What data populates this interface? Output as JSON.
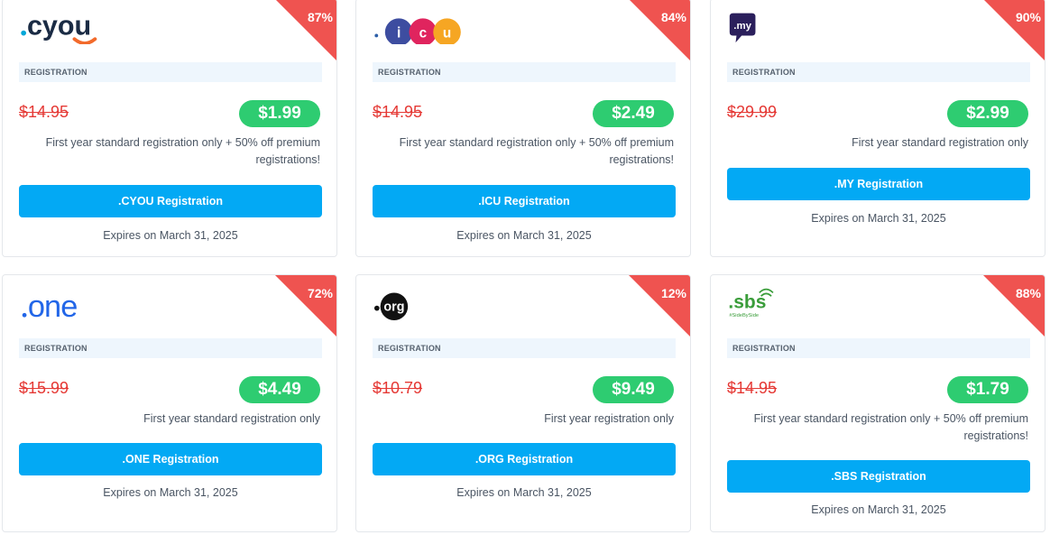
{
  "cards": [
    {
      "logo_text": ".cyou",
      "discount": "87%",
      "label": "REGISTRATION",
      "old_price": "$14.95",
      "new_price": "$1.99",
      "description": "First year standard registration only + 50% off premium registrations!",
      "button": ".CYOU Registration",
      "expires": "Expires on March 31, 2025"
    },
    {
      "logo_text": ".icu",
      "discount": "84%",
      "label": "REGISTRATION",
      "old_price": "$14.95",
      "new_price": "$2.49",
      "description": "First year standard registration only + 50% off premium registrations!",
      "button": ".ICU Registration",
      "expires": "Expires on March 31, 2025"
    },
    {
      "logo_text": ".my",
      "discount": "90%",
      "label": "REGISTRATION",
      "old_price": "$29.99",
      "new_price": "$2.99",
      "description": "First year standard registration only",
      "button": ".MY Registration",
      "expires": "Expires on March 31, 2025"
    },
    {
      "logo_text": ".one",
      "discount": "72%",
      "label": "REGISTRATION",
      "old_price": "$15.99",
      "new_price": "$4.49",
      "description": "First year standard registration only",
      "button": ".ONE Registration",
      "expires": "Expires on March 31, 2025"
    },
    {
      "logo_text": ".org",
      "discount": "12%",
      "label": "REGISTRATION",
      "old_price": "$10.79",
      "new_price": "$9.49",
      "description": "First year registration only",
      "button": ".ORG Registration",
      "expires": "Expires on March 31, 2025"
    },
    {
      "logo_text": ".sbs",
      "logo_tagline": "#SideBySide",
      "discount": "88%",
      "label": "REGISTRATION",
      "old_price": "$14.95",
      "new_price": "$1.79",
      "description": "First year standard registration only + 50% off premium registrations!",
      "button": ".SBS Registration",
      "expires": "Expires on March 31, 2025"
    }
  ],
  "colors": {
    "discount_ribbon": "#ef5350",
    "old_price": "#e53935",
    "new_price_bg": "#2ecc71",
    "button_bg": "#03a9f4",
    "label_bg": "#eef6fd"
  }
}
